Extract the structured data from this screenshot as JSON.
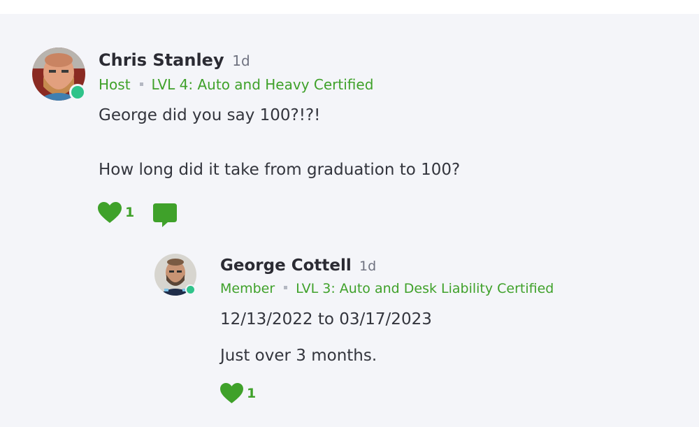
{
  "colors": {
    "accent": "#3fa12a",
    "online": "#2fc38a",
    "panel": "#f4f5f9"
  },
  "comment": {
    "author": "Chris Stanley",
    "time": "1d",
    "role": "Host",
    "level": "LVL 4: Auto and Heavy Certified",
    "paragraphs": [
      "George did you say 100?!?!",
      "How long did it take from graduation to 100?"
    ],
    "like_count": "1",
    "avatar_icon": "avatar-photo",
    "like_icon": "heart-icon",
    "reply_icon": "comment-bubble-icon"
  },
  "reply": {
    "author": "George Cottell",
    "time": "1d",
    "role": "Member",
    "level": "LVL 3: Auto and Desk Liability Certified",
    "paragraphs": [
      "12/13/2022 to 03/17/2023",
      "Just over 3 months."
    ],
    "like_count": "1",
    "avatar_icon": "avatar-photo",
    "like_icon": "heart-icon"
  }
}
